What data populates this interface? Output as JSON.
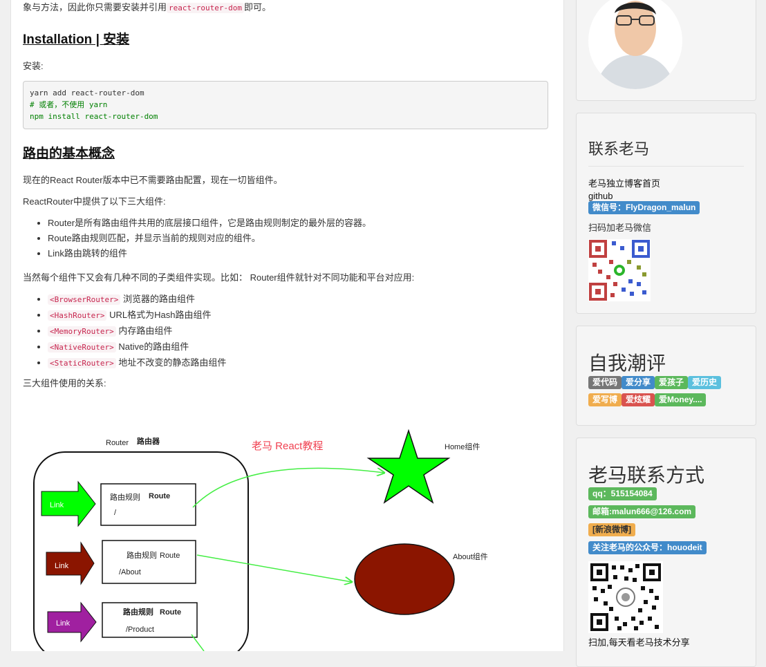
{
  "article": {
    "intro_text": "象与方法，因此你只需要安装并引用",
    "intro_code": "react-router-dom",
    "intro_tail": "即可。",
    "installation_heading": "Installation | 安装",
    "install_label": "安装:",
    "code_lines": [
      "yarn add react-router-dom",
      "# 或者，不使用 yarn",
      "npm install react-router-dom"
    ],
    "concept_heading": "路由的基本概念",
    "para1": "现在的React Router版本中已不需要路由配置，现在一切皆组件。",
    "para2": "ReactRouter中提供了以下三大组件:",
    "components": [
      "Router是所有路由组件共用的底层接口组件，它是路由规则制定的最外层的容器。",
      "Route路由规则匹配，并显示当前的规则对应的组件。",
      "Link路由跳转的组件"
    ],
    "para3": "当然每个组件下又会有几种不同的子类组件实现。比如： Router组件就针对不同功能和平台对应用:",
    "router_types": [
      {
        "code": "<BrowserRouter>",
        "desc": "浏览器的路由组件"
      },
      {
        "code": "<HashRouter>",
        "desc": "URL格式为Hash路由组件"
      },
      {
        "code": "<MemoryRouter>",
        "desc": "内存路由组件"
      },
      {
        "code": "<NativeRouter>",
        "desc": "Native的路由组件"
      },
      {
        "code": "<StaticRouter>",
        "desc": "地址不改变的静态路由组件"
      }
    ],
    "para4": "三大组件使用的关系:"
  },
  "diagram": {
    "router_label": "Router",
    "router_cn": "路由器",
    "watermark": "老马 React教程",
    "home_label": "Home组件",
    "about_label": "About组件",
    "link_label": "Link",
    "route_rules": [
      {
        "rule": "路由规则",
        "route": "Route",
        "path": "/"
      },
      {
        "rule": "路由规则",
        "route": "Route",
        "path": "/About"
      },
      {
        "rule": "路由规则",
        "route": "Route",
        "path": "/Product"
      }
    ],
    "colors": {
      "star": "#00ff00",
      "ellipse": "#8b1500",
      "link1": "#00ff00",
      "link2": "#8b1500",
      "link3": "#a020a0",
      "arrow": "#44ee44",
      "watermark": "#f04050"
    }
  },
  "sidebar": {
    "contact": {
      "title": "联系老马",
      "blog_home": "老马独立博客首页",
      "github": "github",
      "wechat_badge": "微信号：FlyDragon_malun",
      "scan_text": "扫码加老马微信"
    },
    "self_review": {
      "title": "自我潮评",
      "tags": [
        {
          "text": "爱代码",
          "color": "grey"
        },
        {
          "text": "爱分享",
          "color": "blue"
        },
        {
          "text": "爱孩子",
          "color": "green"
        },
        {
          "text": "爱历史",
          "color": "cyan"
        },
        {
          "text": "爱写博",
          "color": "orange"
        },
        {
          "text": "爱炫耀",
          "color": "red"
        },
        {
          "text": "爱Money....",
          "color": "green"
        }
      ]
    },
    "contact_methods": {
      "title": "老马联系方式",
      "qq": "qq：515154084",
      "email": "邮箱:malun666@126.com",
      "weibo": "[新浪微博]",
      "wechat_public": "关注老马的公众号：houodeit",
      "bottom_text": "扫加,每天看老马技术分享"
    }
  }
}
